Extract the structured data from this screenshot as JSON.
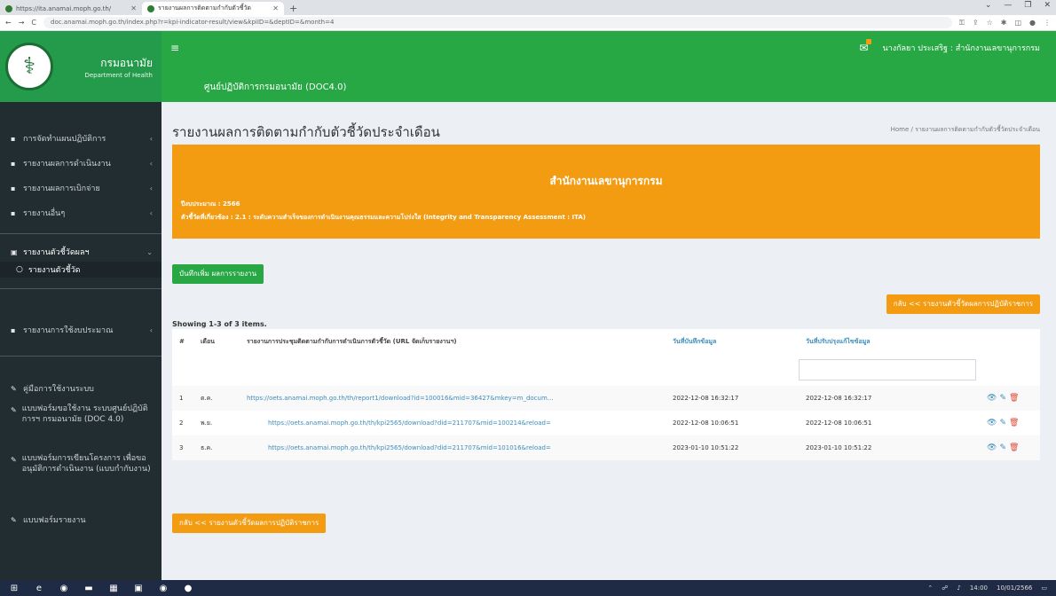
{
  "browser": {
    "tabs": [
      {
        "label": "https://ita.anamai.moph.go.th/"
      },
      {
        "label": "รายงานผลการติดตามกำกับตัวชี้วัด"
      }
    ],
    "new_tab": "+",
    "window_controls": [
      "⌄",
      "—",
      "❐",
      "✕"
    ],
    "nav": [
      "←",
      "→",
      "C"
    ],
    "url": "doc.anamai.moph.go.th/index.php?r=kpi-indicator-result/view&kpiID=&deptID=&month=4"
  },
  "header": {
    "logo_title": "กรมอนามัย",
    "logo_subtitle": "Department of Health",
    "menu_icon": "≡",
    "system_title": "ศูนย์ปฏิบัติการกรมอนามัย (DOC4.0)",
    "user_name": "นางกัลยา ประเสริฐ : สำนักงานเลขานุการกรม"
  },
  "sidebar": {
    "items": [
      {
        "label": "การจัดทำแผนปฏิบัติการ"
      },
      {
        "label": "รายงานผลการดำเนินงาน"
      },
      {
        "label": "รายงานผลการเบิกจ่าย"
      },
      {
        "label": "รายงานอื่นๆ"
      },
      {
        "label": "รายงานตัวชี้วัดผลฯ"
      },
      {
        "label": "รายงานตัวชี้วัด"
      },
      {
        "label": "รายงานการใช้งบประมาณ"
      },
      {
        "label": "คู่มือการใช้งานระบบ"
      },
      {
        "label": "แบบฟอร์มขอใช้งาน ระบบศูนย์ปฏิบัติการฯ กรมอนามัย (DOC 4.0)"
      },
      {
        "label": "แบบฟอร์มการเขียนโครงการ เพื่อขออนุมัติการดำเนินงาน (แบบกำกับงาน)"
      },
      {
        "label": "แบบฟอร์มรายงาน"
      }
    ]
  },
  "content": {
    "page_title": "รายงานผลการติดตามกำกับตัวชี้วัดประจำเดือน",
    "breadcrumb": "Home  /  รายงานผลการติดตามกำกับตัวชี้วัดประจำเดือน",
    "banner": {
      "title": "สำนักงานเลขานุการกรม",
      "fiscal_year": "ปีงบประมาณ : 2566",
      "indicator": "ตัวชี้วัดที่เกี่ยวข้อง : 2.1 : ระดับความสำเร็จของการดำเนินงานคุณธรรมและความโปร่งใส (Integrity and Transparency Assessment : ITA)"
    },
    "add_button": "บันทึกเพิ่ม ผลการรายงาน",
    "back_button": "กลับ << รายงานตัวชี้วัดผลการปฏิบัติราชการ",
    "summary": "Showing 1-3 of 3 items.",
    "table": {
      "headers": [
        "#",
        "เดือน",
        "รายงานการประชุมติดตามกำกับการดำเนินการตัวชี้วัด (URL จัดเก็บรายงานฯ)",
        "วันที่บันทึกข้อมูล",
        "วันที่ปรับปรุงแก้ไขข้อมูล"
      ],
      "rows": [
        {
          "no": "1",
          "month": "ต.ค.",
          "url": "https://oets.anamai.moph.go.th/th/report1/download?id=100016&mid=36427&mkey=m_docum...",
          "created": "2022-12-08 16:32:17",
          "updated": "2022-12-08 16:32:17"
        },
        {
          "no": "2",
          "month": "พ.ย.",
          "url": "https://oets.anamai.moph.go.th/th/kpi2565/download?did=211707&mid=100214&reload=",
          "created": "2022-12-08 10:06:51",
          "updated": "2022-12-08 10:06:51"
        },
        {
          "no": "3",
          "month": "ธ.ค.",
          "url": "https://oets.anamai.moph.go.th/th/kpi2565/download?did=211707&mid=101016&reload=",
          "created": "2023-01-10 10:51:22",
          "updated": "2023-01-10 10:51:22"
        }
      ],
      "action_icons": [
        "view-icon",
        "edit-icon",
        "delete-icon"
      ]
    }
  },
  "taskbar": {
    "time": "14:00",
    "date": "10/01/2566"
  },
  "colors": {
    "header_green": "#28a745",
    "banner_orange": "#f39c12",
    "sidebar_dark": "#222d32",
    "link_blue": "#3c8dbc"
  }
}
